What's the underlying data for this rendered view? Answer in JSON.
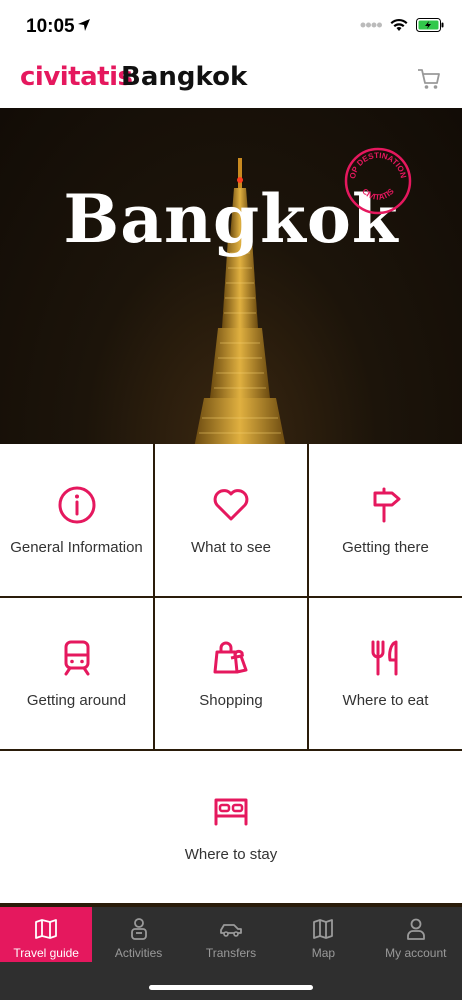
{
  "status_bar": {
    "time": "10:05"
  },
  "header": {
    "brand": "civitatis",
    "city": "Bangkok",
    "cart_icon": "cart-icon"
  },
  "hero": {
    "title": "Bangkok",
    "stamp_top": "TOP DESTINATIONS",
    "stamp_bottom": "CIVITATIS"
  },
  "menu": {
    "items": [
      {
        "label": "General Information",
        "icon": "info-icon"
      },
      {
        "label": "What to see",
        "icon": "heart-icon"
      },
      {
        "label": "Getting there",
        "icon": "signpost-icon"
      },
      {
        "label": "Getting around",
        "icon": "train-icon"
      },
      {
        "label": "Shopping",
        "icon": "shopping-bags-icon"
      },
      {
        "label": "Where to eat",
        "icon": "fork-knife-icon"
      },
      {
        "label": "Where to stay",
        "icon": "bed-icon"
      }
    ]
  },
  "tabs": [
    {
      "label": "Travel guide",
      "icon": "map-book-icon",
      "active": true
    },
    {
      "label": "Activities",
      "icon": "person-icon"
    },
    {
      "label": "Transfers",
      "icon": "car-icon"
    },
    {
      "label": "Map",
      "icon": "map-icon"
    },
    {
      "label": "My account",
      "icon": "account-icon"
    }
  ],
  "colors": {
    "accent": "#e5185e",
    "tabbar": "#2f2f2f",
    "text": "#333333"
  }
}
